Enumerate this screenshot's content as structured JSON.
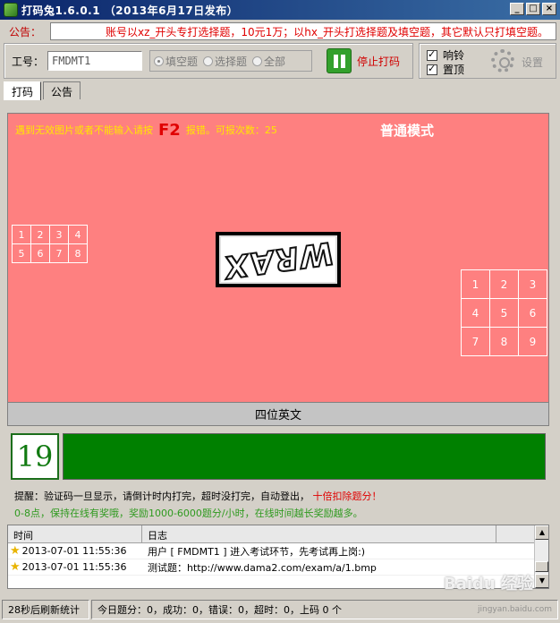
{
  "window": {
    "title": "打码兔1.6.0.1 （2013年6月17日发布）"
  },
  "notice": {
    "label": "公告：",
    "text": "账号以xz_开头专打选择题，10元1万；以hx_开头打选择题及填空题，其它默认只打填空题。"
  },
  "controls": {
    "workno_label": "工号：",
    "workno_value": "FMDMT1",
    "modes": [
      "填空题",
      "选择题",
      "全部"
    ],
    "selected_mode": "填空题",
    "stop_label": "停止打码"
  },
  "options": {
    "ring_label": "响铃",
    "ring_checked": true,
    "topmost_label": "置顶",
    "topmost_checked": true,
    "settings_label": "设置"
  },
  "tabs": [
    {
      "label": "打码",
      "active": true
    },
    {
      "label": "公告",
      "active": false
    }
  ],
  "panel": {
    "hint_before": "遇到无效图片或者不能输入请按",
    "hint_key": "F2",
    "hint_after": "报错。可报次数：25",
    "mode_title": "普通模式",
    "small_grid": [
      [
        "1",
        "2",
        "3",
        "4"
      ],
      [
        "5",
        "6",
        "7",
        "8"
      ]
    ],
    "big_grid": [
      [
        "1",
        "2",
        "3"
      ],
      [
        "4",
        "5",
        "6"
      ],
      [
        "7",
        "8",
        "9"
      ]
    ],
    "captcha_text": "WRAX",
    "type_label": "四位英文",
    "background_color": "#fe8080"
  },
  "timer": {
    "countdown": "19"
  },
  "tips": {
    "reminder": "提醒：验证码一旦显示，请倒计时内打完，超时没打完，自动登出，",
    "reminder_red": "十倍扣除题分！",
    "reward": "0-8点，保持在线有奖哦，奖励1000-6000题分/小时，在线时间越长奖励越多。"
  },
  "log": {
    "headers": [
      "时间",
      "日志"
    ],
    "rows": [
      {
        "time": "2013-07-01 11:55:36",
        "text": "用户 [ FMDMT1 ] 进入考试环节，先考试再上岗:)"
      },
      {
        "time": "2013-07-01 11:55:36",
        "text": "测试题：http://www.dama2.com/exam/a/1.bmp"
      }
    ]
  },
  "status": {
    "refresh": "28秒后刷新统计",
    "stats": "今日题分：0，成功：0，错误：0，超时：0，上码 0 个"
  },
  "watermark": {
    "text": "Baidu 经验",
    "sub": "jingyan.baidu.com"
  }
}
